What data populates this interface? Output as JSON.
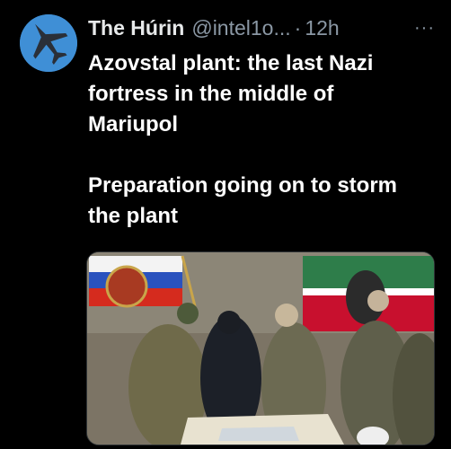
{
  "tweet": {
    "author_name": "The Húrin",
    "handle": "@intel1o...",
    "separator": "·",
    "time": "12h",
    "more_label": "···",
    "text_line1": "Azovstal plant: the last Nazi fortress in the middle of Mariupol",
    "text_line2": "Preparation going on to storm the plant",
    "avatar_icon": "fighter-jet-icon",
    "media_icon": "photo-icon"
  },
  "colors": {
    "background": "#000000",
    "text_primary": "#ffffff",
    "text_secondary": "#8b98a5",
    "avatar_bg": "#3f8fd6"
  }
}
